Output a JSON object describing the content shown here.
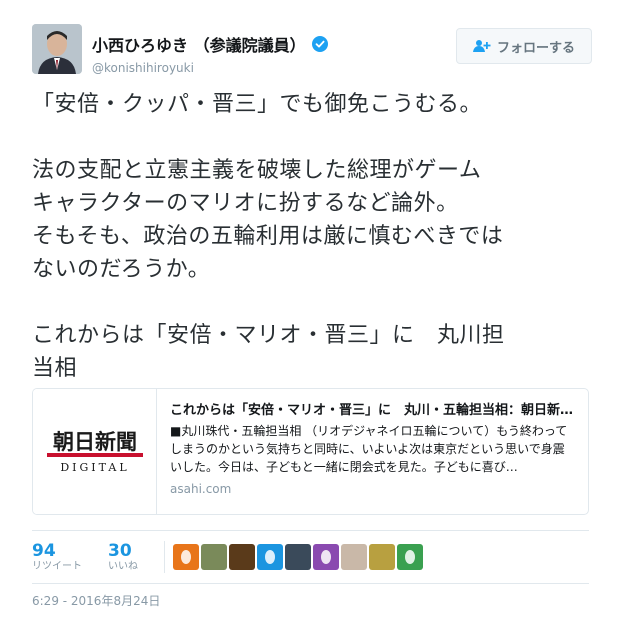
{
  "user": {
    "name": "小西ひろゆき （参議院議員）",
    "screen_name": "@konishihiroyuki",
    "verified": true
  },
  "follow_button": {
    "label": "フォローする",
    "icon": "add-user-icon"
  },
  "tweet": {
    "text": "「安倍・クッパ・晋三」でも御免こうむる。\n\n法の支配と立憲主義を破壊した総理がゲーム\nキャラクターのマリオに扮するなど論外。\nそもそも、政治の五輪利用は厳に慎むべきでは\nないのだろうか。\n\nこれからは「安倍・マリオ・晋三」に　丸川担\n当相"
  },
  "card": {
    "logo_text": "朝日新聞",
    "logo_sub": "DIGITAL",
    "title": "これからは「安倍・マリオ・晋三」に　丸川・五輪担当相：朝日新…",
    "description": "■丸川珠代・五輪担当相 （リオデジャネイロ五輪について）もう終わってしまうのかという気持ちと同時に、いよいよ次は東京だという思いで身震いした。今日は、子どもと一緒に閉会式を見た。子どもに喜び…",
    "domain": "asahi.com"
  },
  "stats": {
    "retweets": {
      "count": "94",
      "label": "リツイート"
    },
    "likes": {
      "count": "30",
      "label": "いいね"
    }
  },
  "likers": [
    {
      "type": "egg",
      "color": "#e8751a"
    },
    {
      "type": "photo",
      "color": "#7a8a5a"
    },
    {
      "type": "photo",
      "color": "#5a3a1a"
    },
    {
      "type": "egg",
      "color": "#1b95e0"
    },
    {
      "type": "photo",
      "color": "#3a4a5a"
    },
    {
      "type": "egg",
      "color": "#8a4ab0"
    },
    {
      "type": "photo",
      "color": "#c9b8a8"
    },
    {
      "type": "photo",
      "color": "#b8a040"
    },
    {
      "type": "egg",
      "color": "#3aa050"
    }
  ],
  "timestamp": "6:29 - 2016年8月24日",
  "colors": {
    "accent": "#1b95e0",
    "muted": "#8899a6",
    "text": "#292f33"
  }
}
